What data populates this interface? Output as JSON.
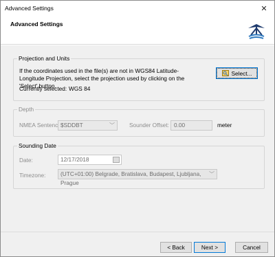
{
  "window": {
    "title": "Advanced Settings",
    "close_icon": "close-icon"
  },
  "header": {
    "title": "Advanced Settings",
    "logo_icon": "boat-logo-icon"
  },
  "projection": {
    "legend": "Projection and Units",
    "description": "If the coordinates used in the file(s) are not in WGS84 Latitude-Longitude Projection, select the projection used by clicking on the 'Select' button.",
    "currently_selected_label": "Currently selected:",
    "currently_selected_value": "WGS 84",
    "select_button": "Select..."
  },
  "depth": {
    "legend": "Depth",
    "nmea_label": "NMEA Sentence:",
    "nmea_value": "$SDDBT",
    "offset_label": "Sounder Offset:",
    "offset_value": "0.00",
    "unit": "meter"
  },
  "sounding": {
    "legend": "Sounding Date",
    "date_label": "Date:",
    "date_value": "12/17/2018",
    "timezone_label": "Timezone:",
    "timezone_value": "(UTC+01:00) Belgrade, Bratislava, Budapest, Ljubljana, Prague"
  },
  "footer": {
    "back": "< Back",
    "next": "Next >",
    "cancel": "Cancel"
  }
}
